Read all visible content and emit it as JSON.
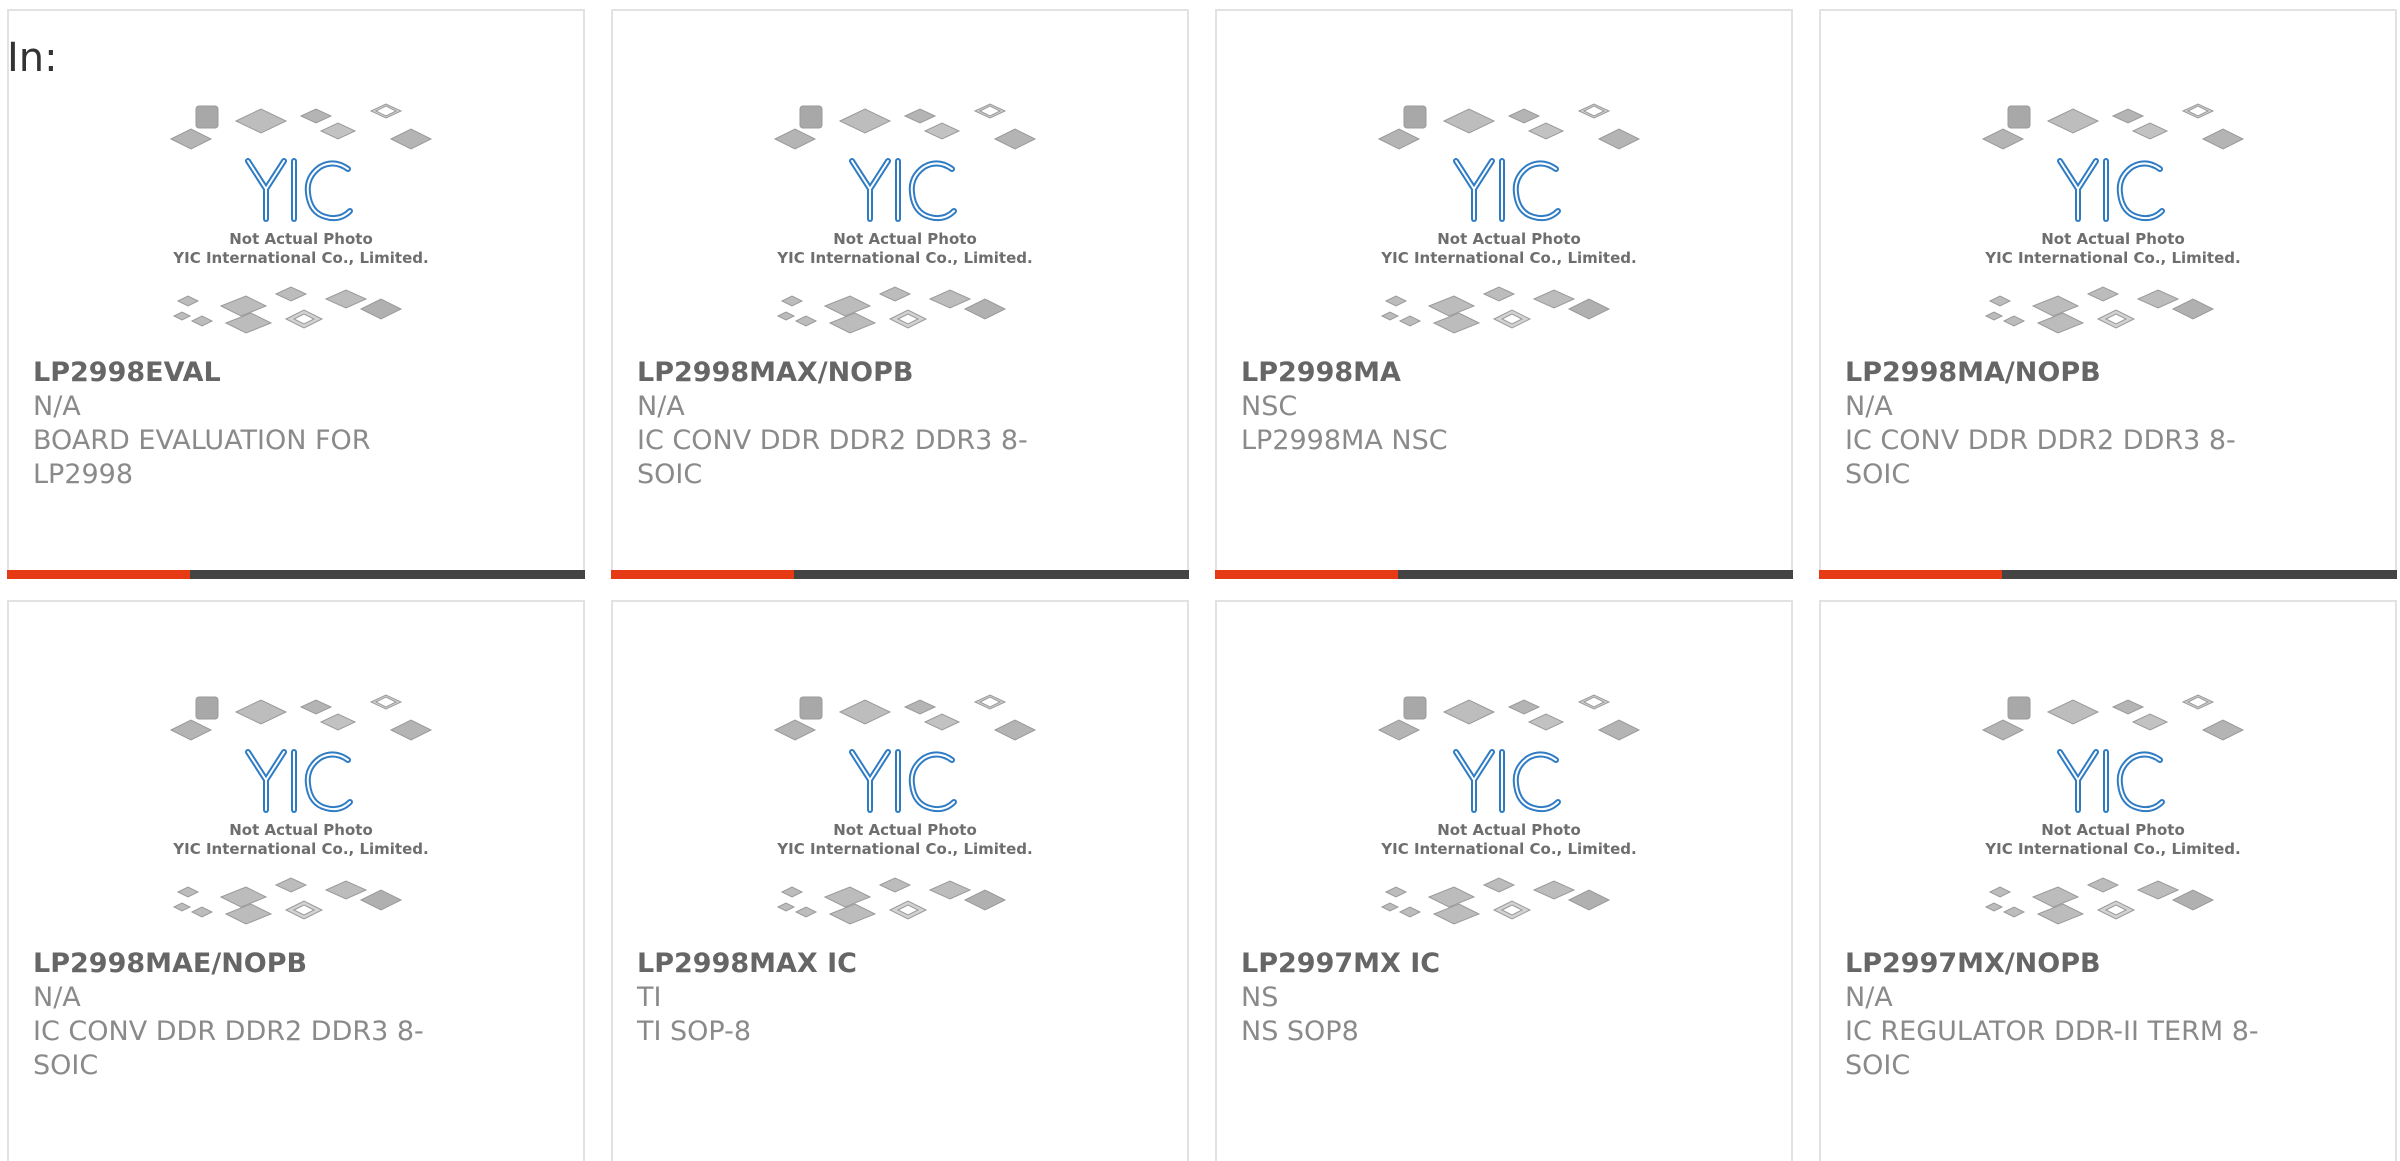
{
  "header": {
    "in_label": "In:"
  },
  "photo": {
    "caption_line1": "Not Actual Photo",
    "caption_line2": "YIC International Co., Limited.",
    "logo_text": "YIC"
  },
  "colors": {
    "accent": "#e63a14",
    "bar_dark": "#444444",
    "logo_blue": "#1e6fb8",
    "card_border": "#e2e2e2"
  },
  "products": [
    {
      "part": "LP2998EVAL",
      "mfr": "N/A",
      "desc": "BOARD EVALUATION FOR LP2998"
    },
    {
      "part": "LP2998MAX/NOPB",
      "mfr": "N/A",
      "desc": "IC CONV DDR DDR2 DDR3 8-SOIC"
    },
    {
      "part": "LP2998MA",
      "mfr": "NSC",
      "desc": "LP2998MA NSC"
    },
    {
      "part": "LP2998MA/NOPB",
      "mfr": "N/A",
      "desc": "IC CONV DDR DDR2 DDR3 8-SOIC"
    },
    {
      "part": "LP2998MAE/NOPB",
      "mfr": "N/A",
      "desc": "IC CONV DDR DDR2 DDR3 8-SOIC"
    },
    {
      "part": "LP2998MAX IC",
      "mfr": "TI",
      "desc": "TI SOP-8"
    },
    {
      "part": "LP2997MX IC",
      "mfr": "NS",
      "desc": "NS SOP8"
    },
    {
      "part": "LP2997MX/NOPB",
      "mfr": "N/A",
      "desc": "IC REGULATOR DDR-II TERM 8-SOIC"
    }
  ]
}
